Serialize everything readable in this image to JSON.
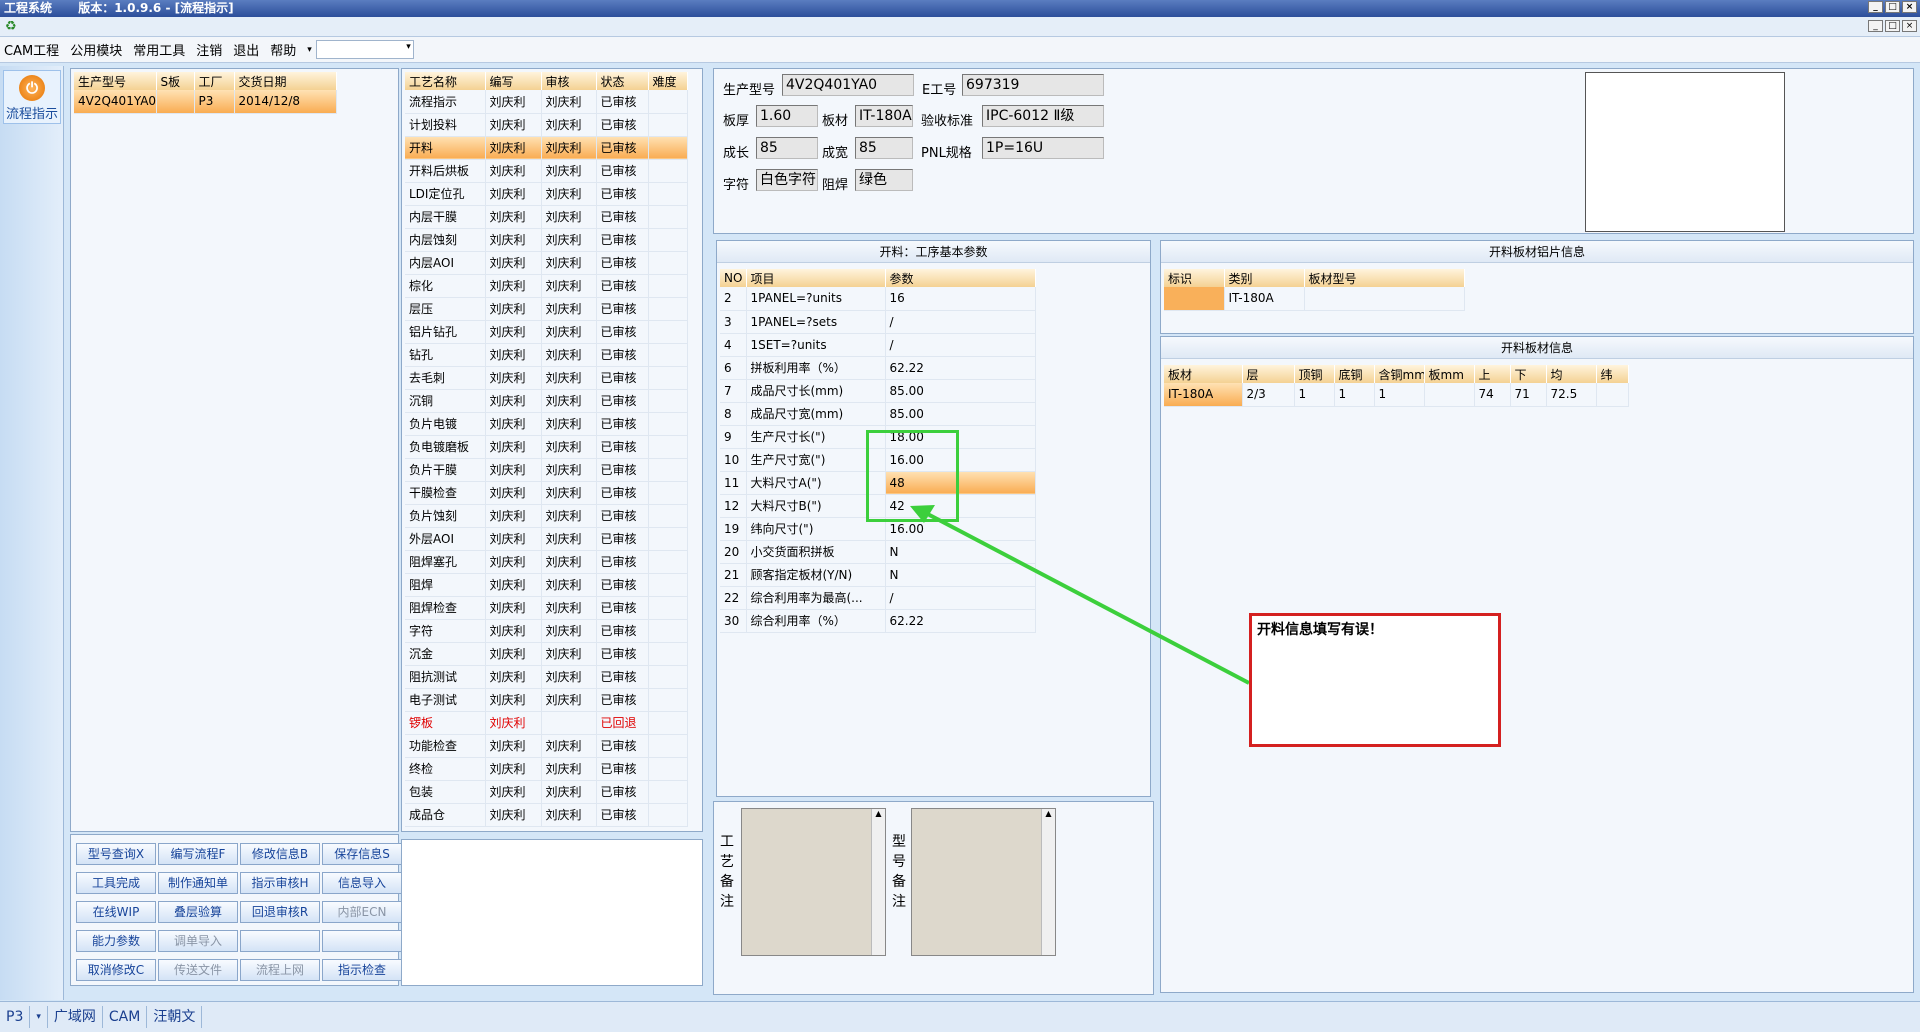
{
  "titlebar": {
    "app": "工程系统",
    "version": "版本：1.0.9.6 - [流程指示]"
  },
  "window_buttons": [
    "_",
    "□",
    "×"
  ],
  "menu": [
    "CAM工程",
    "公用模块",
    "常用工具",
    "注销",
    "退出",
    "帮助"
  ],
  "leftbar": {
    "flow_label": "流程指示"
  },
  "orders": {
    "headers": [
      "生产型号",
      "S板",
      "工厂",
      "交货日期"
    ],
    "rows": [
      [
        "4V2Q401YA0",
        "",
        "P3",
        "2014/12/8"
      ]
    ]
  },
  "process": {
    "headers": [
      "工艺名称",
      "编写",
      "审核",
      "状态",
      "难度"
    ],
    "rows": [
      [
        "流程指示",
        "刘庆利",
        "刘庆利",
        "已审核",
        ""
      ],
      [
        "计划投料",
        "刘庆利",
        "刘庆利",
        "已审核",
        ""
      ],
      [
        "开料",
        "刘庆利",
        "刘庆利",
        "已审核",
        ""
      ],
      [
        "开料后烘板",
        "刘庆利",
        "刘庆利",
        "已审核",
        ""
      ],
      [
        "LDI定位孔",
        "刘庆利",
        "刘庆利",
        "已审核",
        ""
      ],
      [
        "内层干膜",
        "刘庆利",
        "刘庆利",
        "已审核",
        ""
      ],
      [
        "内层蚀刻",
        "刘庆利",
        "刘庆利",
        "已审核",
        ""
      ],
      [
        "内层AOI",
        "刘庆利",
        "刘庆利",
        "已审核",
        ""
      ],
      [
        "棕化",
        "刘庆利",
        "刘庆利",
        "已审核",
        ""
      ],
      [
        "层压",
        "刘庆利",
        "刘庆利",
        "已审核",
        ""
      ],
      [
        "铝片钻孔",
        "刘庆利",
        "刘庆利",
        "已审核",
        ""
      ],
      [
        "钻孔",
        "刘庆利",
        "刘庆利",
        "已审核",
        ""
      ],
      [
        "去毛刺",
        "刘庆利",
        "刘庆利",
        "已审核",
        ""
      ],
      [
        "沉铜",
        "刘庆利",
        "刘庆利",
        "已审核",
        ""
      ],
      [
        "负片电镀",
        "刘庆利",
        "刘庆利",
        "已审核",
        ""
      ],
      [
        "负电镀磨板",
        "刘庆利",
        "刘庆利",
        "已审核",
        ""
      ],
      [
        "负片干膜",
        "刘庆利",
        "刘庆利",
        "已审核",
        ""
      ],
      [
        "干膜检查",
        "刘庆利",
        "刘庆利",
        "已审核",
        ""
      ],
      [
        "负片蚀刻",
        "刘庆利",
        "刘庆利",
        "已审核",
        ""
      ],
      [
        "外层AOI",
        "刘庆利",
        "刘庆利",
        "已审核",
        ""
      ],
      [
        "阻焊塞孔",
        "刘庆利",
        "刘庆利",
        "已审核",
        ""
      ],
      [
        "阻焊",
        "刘庆利",
        "刘庆利",
        "已审核",
        ""
      ],
      [
        "阻焊检查",
        "刘庆利",
        "刘庆利",
        "已审核",
        ""
      ],
      [
        "字符",
        "刘庆利",
        "刘庆利",
        "已审核",
        ""
      ],
      [
        "沉金",
        "刘庆利",
        "刘庆利",
        "已审核",
        ""
      ],
      [
        "阻抗测试",
        "刘庆利",
        "刘庆利",
        "已审核",
        ""
      ],
      [
        "电子测试",
        "刘庆利",
        "刘庆利",
        "已审核",
        ""
      ],
      [
        "锣板",
        "刘庆利",
        "",
        "已回退",
        ""
      ],
      [
        "功能检查",
        "刘庆利",
        "刘庆利",
        "已审核",
        ""
      ],
      [
        "终检",
        "刘庆利",
        "刘庆利",
        "已审核",
        ""
      ],
      [
        "包装",
        "刘庆利",
        "刘庆利",
        "已审核",
        ""
      ],
      [
        "成品仓",
        "刘庆利",
        "刘庆利",
        "已审核",
        ""
      ]
    ]
  },
  "buttons": [
    [
      "型号查询X",
      "编写流程F",
      "修改信息B",
      "保存信息S"
    ],
    [
      "工具完成",
      "制作通知单",
      "指示审核H",
      "信息导入"
    ],
    [
      "在线WIP",
      "叠层验算",
      "回退审核R",
      "内部ECN"
    ],
    [
      "能力参数",
      "调单导入",
      "",
      ""
    ],
    [
      "取消修改C",
      "传送文件",
      "流程上网",
      "指示检查"
    ]
  ],
  "info": {
    "prod_model_label": "生产型号",
    "prod_model": "4V2Q401YA0",
    "e_no_label": "E工号",
    "e_no": "697319",
    "thickness_label": "板厚",
    "thickness": "1.60",
    "material_label": "板材",
    "material": "IT-180A",
    "standard_label": "验收标准",
    "standard": "IPC-6012 Ⅱ级",
    "len_label": "成长",
    "len": "85",
    "wid_label": "成宽",
    "wid": "85",
    "pnl_label": "PNL规格",
    "pnl": "1P=16U",
    "char_label": "字符",
    "char": "白色字符",
    "mask_label": "阻焊",
    "mask": "绿色"
  },
  "params": {
    "title": "开料：工序基本参数",
    "headers": [
      "NO",
      "项目",
      "参数"
    ],
    "rows": [
      [
        "2",
        "1PANEL=?units",
        "16"
      ],
      [
        "3",
        "1PANEL=?sets",
        "/"
      ],
      [
        "4",
        "1SET=?units",
        "/"
      ],
      [
        "6",
        "拼板利用率（%）",
        "62.22"
      ],
      [
        "7",
        "成品尺寸长(mm)",
        "85.00"
      ],
      [
        "8",
        "成品尺寸宽(mm)",
        "85.00"
      ],
      [
        "9",
        "生产尺寸长(\")",
        "18.00"
      ],
      [
        "10",
        "生产尺寸宽(\")",
        "16.00"
      ],
      [
        "11",
        "大料尺寸A(\")",
        "48"
      ],
      [
        "12",
        "大料尺寸B(\")",
        "42"
      ],
      [
        "19",
        "纬向尺寸(\")",
        "16.00"
      ],
      [
        "20",
        "小交货面积拼板",
        "N"
      ],
      [
        "21",
        "顾客指定板材(Y/N)",
        "N"
      ],
      [
        "22",
        "综合利用率为最高(...",
        "/"
      ],
      [
        "30",
        "综合利用率（%）",
        "62.22"
      ]
    ]
  },
  "sheet": {
    "title": "开料板材铝片信息",
    "headers": [
      "标识",
      "类别",
      "板材型号"
    ],
    "rows": [
      [
        "",
        "IT-180A",
        ""
      ]
    ]
  },
  "board": {
    "title": "开料板材信息",
    "headers": [
      "板材",
      "层",
      "顶铜",
      "底铜",
      "含铜mm",
      "板mm",
      "上",
      "下",
      "均",
      "纬"
    ],
    "rows": [
      [
        "IT-180A",
        "2/3",
        "1",
        "1",
        "1",
        "",
        "74",
        "71",
        "72.5",
        ""
      ]
    ]
  },
  "remarks": {
    "process": "工艺备注",
    "model": "型号备注"
  },
  "callout": "开料信息填写有误！",
  "status": [
    "P3",
    "广域网",
    "CAM",
    "汪朝文"
  ]
}
